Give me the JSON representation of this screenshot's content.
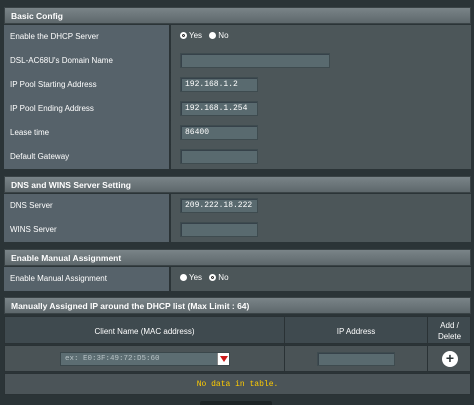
{
  "basic_config": {
    "title": "Basic Config",
    "dhcp_server": {
      "label": "Enable the DHCP Server",
      "yes": "Yes",
      "no": "No",
      "selected": "Yes"
    },
    "domain_name": {
      "label": "DSL-AC68U's Domain Name",
      "value": ""
    },
    "pool_start": {
      "label": "IP Pool Starting Address",
      "value": "192.168.1.2"
    },
    "pool_end": {
      "label": "IP Pool Ending Address",
      "value": "192.168.1.254"
    },
    "lease_time": {
      "label": "Lease time",
      "value": "86400"
    },
    "default_gateway": {
      "label": "Default Gateway",
      "value": ""
    }
  },
  "dns_wins": {
    "title": "DNS and WINS Server Setting",
    "dns_server": {
      "label": "DNS Server",
      "value": "209.222.18.222"
    },
    "wins_server": {
      "label": "WINS Server",
      "value": ""
    }
  },
  "manual_assignment": {
    "title": "Enable Manual Assignment",
    "enable": {
      "label": "Enable Manual Assignment",
      "yes": "Yes",
      "no": "No",
      "selected": "No"
    }
  },
  "assigned_list": {
    "title": "Manually Assigned IP around the DHCP list (Max Limit : 64)",
    "columns": {
      "client": "Client Name (MAC address)",
      "ip": "IP Address",
      "add_line1": "Add /",
      "add_line2": "Delete"
    },
    "mac_placeholder": "ex: E0:3F:49:72:D5:60",
    "ip_value": "",
    "empty_text": "No data in table."
  }
}
